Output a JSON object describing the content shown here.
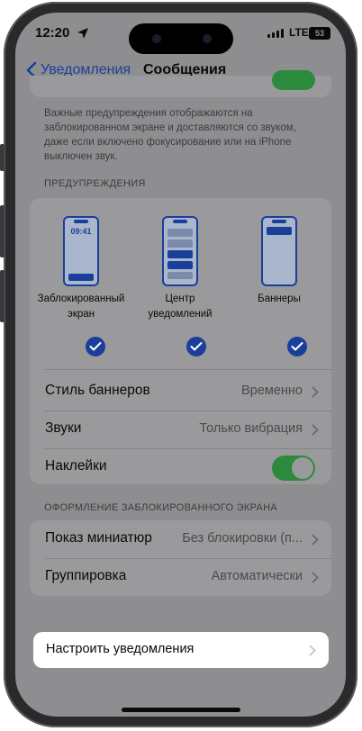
{
  "status_bar": {
    "time": "12:20",
    "network": "LTE",
    "battery": "53"
  },
  "nav": {
    "back_label": "Уведомления",
    "title": "Сообщения"
  },
  "top_footnote": "Важные предупреждения отображаются на заблокированном экране и доставляются со звуком, даже если включено фокусирование или на iPhone выключен звук.",
  "alerts": {
    "header": "ПРЕДУПРЕЖДЕНИЯ",
    "styles": [
      {
        "label_line1": "Заблокированный",
        "label_line2": "экран",
        "preview_time": "09:41",
        "checked": true
      },
      {
        "label_line1": "Центр",
        "label_line2": "уведомлений",
        "checked": true
      },
      {
        "label_line1": "Баннеры",
        "label_line2": "",
        "checked": true
      }
    ],
    "rows": [
      {
        "label": "Стиль баннеров",
        "value": "Временно"
      },
      {
        "label": "Звуки",
        "value": "Только вибрация"
      },
      {
        "label": "Наклейки",
        "toggle": true
      }
    ]
  },
  "lock_screen": {
    "header": "ОФОРМЛЕНИЕ ЗАБЛОКИРОВАННОГО ЭКРАНА",
    "rows": [
      {
        "label": "Показ миниатюр",
        "value": "Без блокировки (п..."
      },
      {
        "label": "Группировка",
        "value": "Автоматически"
      }
    ]
  },
  "customize": {
    "label": "Настроить уведомления"
  },
  "colors": {
    "accent": "#1a3f9a",
    "toggle_on": "#2b8a3e",
    "dim_overlay": "#8e8e90",
    "card": "#9a9a9c"
  }
}
